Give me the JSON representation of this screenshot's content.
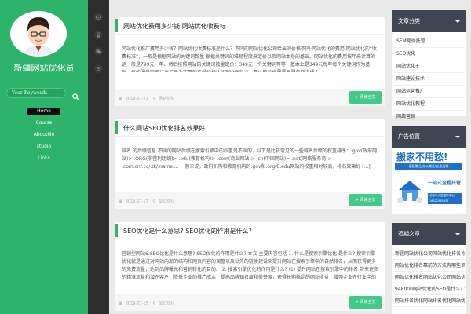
{
  "sidebar": {
    "site_title": "新疆网站优化员",
    "search_placeholder": "Your Keywords",
    "nav": [
      {
        "label": "Home",
        "active": true
      },
      {
        "label": "Course",
        "active": false
      },
      {
        "label": "AboutMe",
        "active": false
      },
      {
        "label": "studio",
        "active": false
      },
      {
        "label": "Links",
        "active": false
      }
    ]
  },
  "posts": [
    {
      "title": "网站优化费用多少钱:网站优化收费标",
      "excerpt": "网站优化推广费用多少钱？网站优化收费标准是什么？不同的网站优化公司给出的价格不同·网站优化的费用,网站优化的“收费标准”，一般是根据网站的关键词数量 根据关键词的难易程度来定价以及网站本身的基础。网站优化的费用按年来计算的话一般是799元一年、然后按照网站的关键词数量定价：349元一个关键词等等，基本上是349元每年每个关键词作为基础，有的服务商还给出了更为实惠的套餐价格比如599元起步，具体的价格需要跟服务商沟通 [...]",
      "date": "2019-07-21",
      "category": "网站优化",
      "button": "+ 阅读全文"
    },
    {
      "title": "什么网站SEO优化排名效果好",
      "excerpt": "域名 的后缀信息 不同的网站后缀在搜索引擎中的权重是不同的，以下是比较常见的一些域名后缀的权重排序：.gov(政府网站)> .ORG(非营利组织)> .edu(教育机构)> .com(商业网站)> .cn(中国网站)> .net(网络服务商)> .com.cn/.cc/.tk/.name.... 一般来说，政府机构和教育机构的.gov和.org和.edu网站的权重相对较高，排名效果好 [...]",
      "date": "2019-07-17",
      "category": "SEO优化",
      "button": "+ 阅读全文"
    },
    {
      "title": "SEO优化是什么意思? SEO优化的作用是什么?",
      "excerpt": "营销型网站6:SEO优化是什么意思? SEO优化的作用是什么? 本文 主要内容包括 1. 什么是搜索引擎优化 是什么? 搜索引擎优化就是通过对网站内部的结构和网页内容的调整以及站外的链接建设来提升网站在搜索引擎中的自然排名，从而获得更多的免费流量，达到品牌曝光和营销转化的目的。 2. 搜索引擎优化的作用是什么? (1) 提升网站在搜索引擎中的排名 带来更多的精准流量和潜在客户，降低企业的推广成本，提高品牌知名度和美誉度，获得长期稳定的网站收益，增强企业在行业中的竞争力和影响力 [...]",
      "date": "2019-07-15",
      "category": "SEO优化",
      "button": "+ 阅读全文"
    }
  ],
  "widgets": {
    "categories": {
      "title": "文章分类",
      "items": [
        "SEM竞价托管",
        "SEO优化",
        "网站优化+",
        "网站建设技术",
        "网站运营推广",
        "网站优化教程",
        "网络营销",
        "网站推广方法"
      ]
    },
    "ad": {
      "title": "广告位置",
      "headline": "搬家不用愁!",
      "sub": "家庭搬迁/办公搬迁/长途运输",
      "badge": "一站式全程托管",
      "footer1": "北京市大型搬家中心",
      "footer2": "18522585537"
    },
    "recent": {
      "title": "近期文章",
      "items": [
        "新疆网站优化公司网站优化排名 优化公司怎么样",
        "网站优化排名靠前的方法有哪些 网站优化",
        "网站优化排名网站优化公司网站优化排名",
        "948000网站优化的SEO是什么? SEO优化",
        "网站排名优化网站排名优化网站优化方法"
      ]
    }
  },
  "colors": {
    "sidebar_green": "#2eb36a",
    "strip_dark": "#2d2d2d",
    "widget_head": "#3f4651",
    "button_green": "#45c98a",
    "page_bg": "#e9e9e9"
  },
  "icons": [
    "weibo-icon",
    "lock-icon",
    "wechat-icon",
    "menu-icon",
    "search-icon",
    "calendar-icon",
    "location-icon"
  ]
}
